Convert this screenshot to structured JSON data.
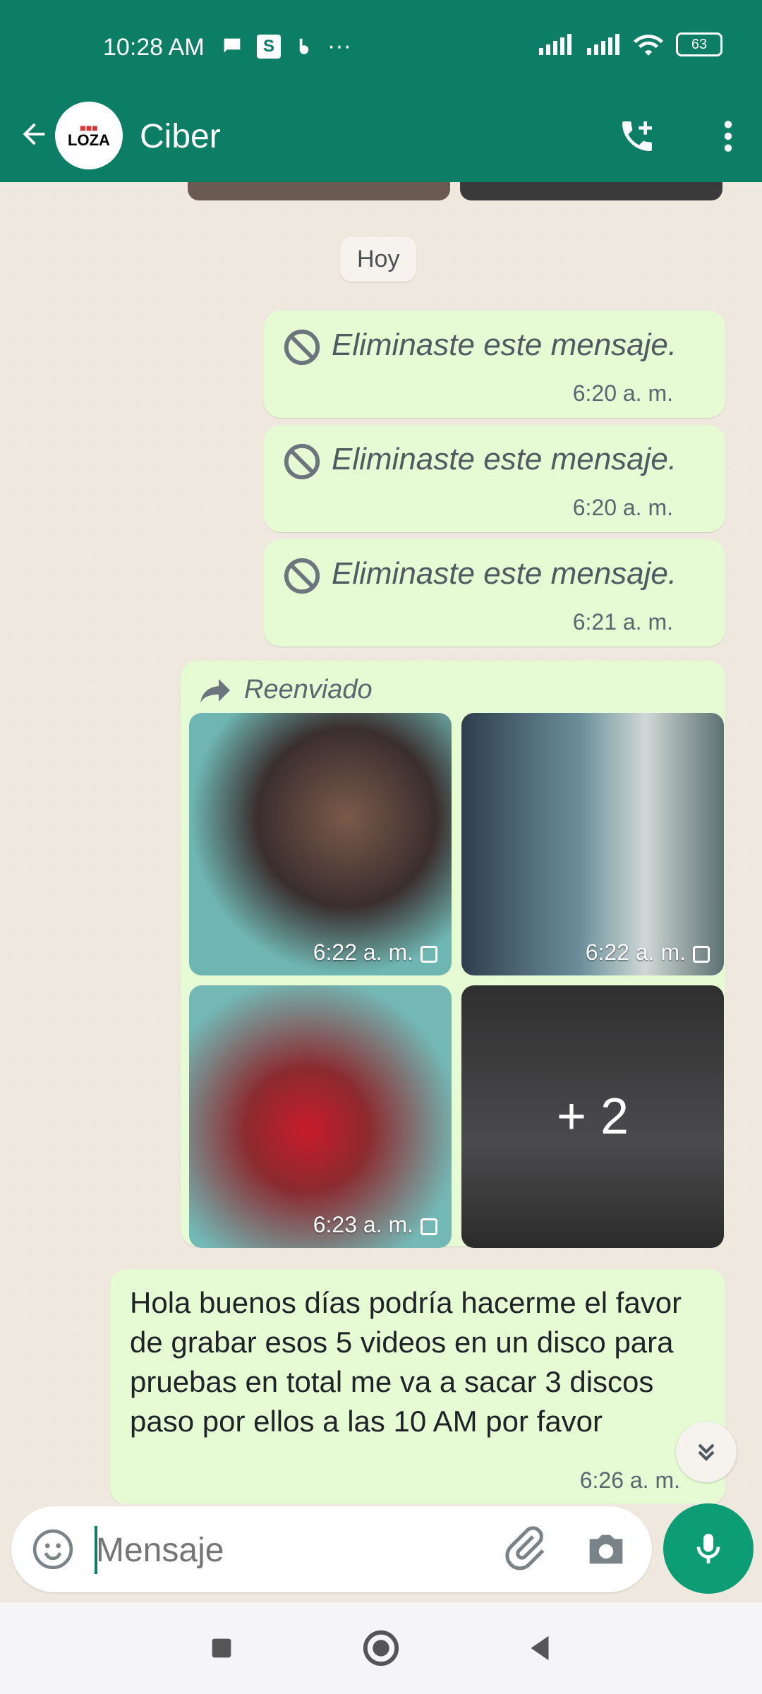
{
  "status_bar": {
    "time": "10:28 AM",
    "dots": "···",
    "battery": "63"
  },
  "header": {
    "title": "Ciber",
    "avatar_text": "LOZA"
  },
  "chat": {
    "day_chip": "Hoy",
    "deleted_messages": [
      {
        "text": "Eliminaste este mensaje.",
        "time": "6:20 a. m."
      },
      {
        "text": "Eliminaste este mensaje.",
        "time": "6:20 a. m."
      },
      {
        "text": "Eliminaste este mensaje.",
        "time": "6:21 a. m."
      }
    ],
    "forwarded": {
      "label": "Reenviado",
      "media": [
        {
          "time": "6:22 a. m."
        },
        {
          "time": "6:22 a. m."
        },
        {
          "time": "6:23 a. m."
        },
        {
          "overlay": "+ 2"
        }
      ]
    },
    "text_message": {
      "text": "Hola buenos días podría hacerme el favor de grabar esos 5 videos en un disco para pruebas en total me va a sacar 3 discos paso por ellos a las 10 AM por favor",
      "time": "6:26 a. m."
    }
  },
  "input": {
    "placeholder": "Mensaje"
  },
  "colors": {
    "header": "#0b7e65",
    "bubble": "#e6fbd4",
    "mic_button": "#0c9d74",
    "chat_background": "#efe8df"
  },
  "icons": {
    "back": "arrow-left-icon",
    "call": "phone-add-icon",
    "more": "more-vertical-icon",
    "deleted": "block-icon",
    "forward": "forward-icon",
    "emoji": "emoji-icon",
    "attach": "paperclip-icon",
    "camera": "camera-icon",
    "mic": "mic-icon",
    "scroll": "double-chevron-down-icon",
    "nav_recent": "square-icon",
    "nav_home": "circle-icon",
    "nav_back": "triangle-left-icon"
  }
}
